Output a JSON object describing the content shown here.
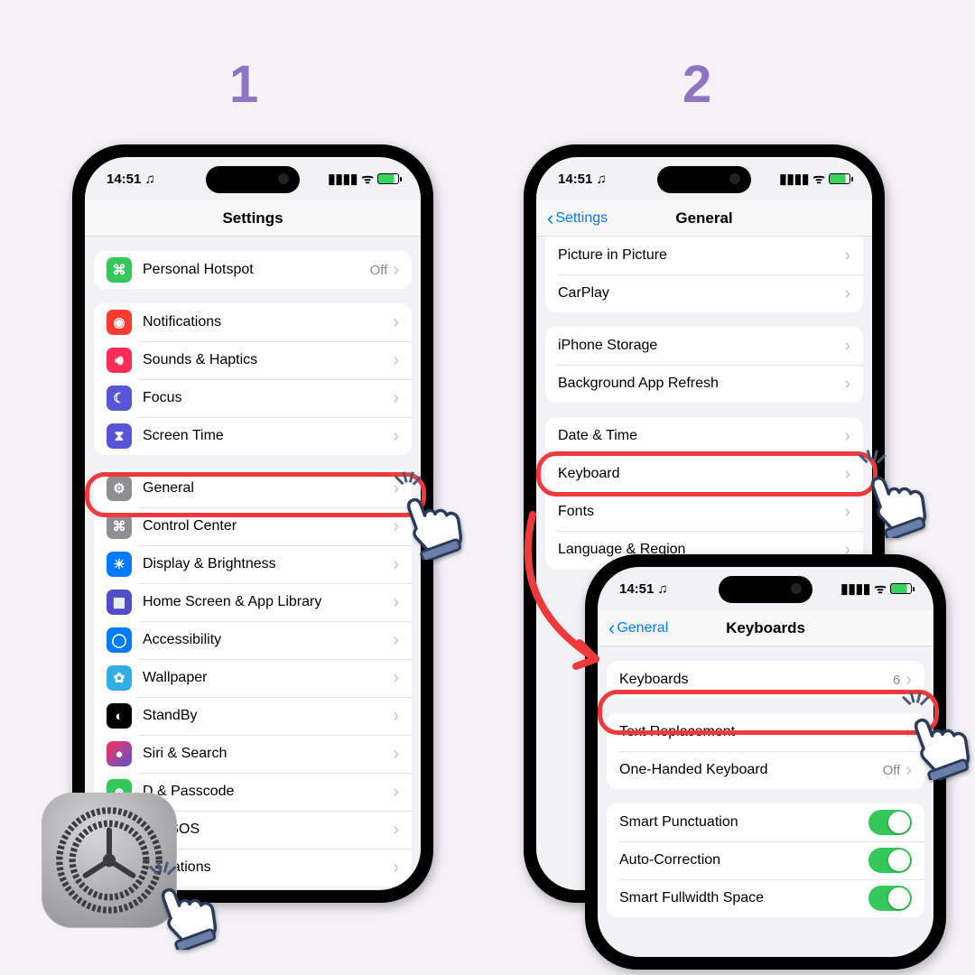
{
  "steps": {
    "one": "1",
    "two": "2"
  },
  "status": {
    "time": "14:51",
    "headphones": "🎧",
    "signal": ".ıll",
    "wifi": "wifi",
    "charge": "⚡︎"
  },
  "phone1": {
    "title": "Settings",
    "g0": [
      {
        "icon": "#34c759",
        "glyph": "link-icon",
        "label": "Personal Hotspot",
        "value": "Off"
      }
    ],
    "g1": [
      {
        "icon": "#ff3b30",
        "glyph": "bell-icon",
        "label": "Notifications"
      },
      {
        "icon": "#ff2d55",
        "glyph": "speaker-icon",
        "label": "Sounds & Haptics"
      },
      {
        "icon": "#5856d6",
        "glyph": "moon-icon",
        "label": "Focus"
      },
      {
        "icon": "#5856d6",
        "glyph": "hourglass-icon",
        "label": "Screen Time"
      }
    ],
    "g2": [
      {
        "icon": "#8e8e93",
        "glyph": "gear-icon",
        "label": "General"
      },
      {
        "icon": "#8e8e93",
        "glyph": "sliders-icon",
        "label": "Control Center"
      },
      {
        "icon": "#007aff",
        "glyph": "sun-icon",
        "label": "Display & Brightness"
      },
      {
        "icon": "#5856d6",
        "glyph": "grid-icon",
        "label": "Home Screen & App Library"
      },
      {
        "icon": "#007aff",
        "glyph": "person-icon",
        "label": "Accessibility"
      },
      {
        "icon": "#32ade6",
        "glyph": "flower-icon",
        "label": "Wallpaper"
      },
      {
        "icon": "#000000",
        "glyph": "standby-icon",
        "label": "StandBy"
      },
      {
        "icon": "#000000",
        "glyph": "siri-icon",
        "label": "Siri & Search"
      },
      {
        "icon": "#34c759",
        "glyph": "faceid-icon",
        "label": "D & Passcode",
        "full": "Face ID & Passcode"
      },
      {
        "icon": "#ff3b30",
        "glyph": "sos-icon",
        "label": "ncy SOS",
        "full": "Emergency SOS"
      },
      {
        "icon": "#ff3b30",
        "glyph": "virus-icon",
        "label": "otifications"
      }
    ]
  },
  "phone2": {
    "title": "General",
    "back": "Settings",
    "g0": [
      {
        "label": "Picture in Picture"
      },
      {
        "label": "CarPlay"
      }
    ],
    "g1": [
      {
        "label": "iPhone Storage"
      },
      {
        "label": "Background App Refresh"
      }
    ],
    "g2": [
      {
        "label": "Date & Time"
      },
      {
        "label": "Keyboard"
      },
      {
        "label": "Fonts"
      },
      {
        "label": "Language & Region"
      }
    ]
  },
  "phone3": {
    "title": "Keyboards",
    "back": "General",
    "g0": [
      {
        "label": "Keyboards",
        "value": "6"
      }
    ],
    "g1": [
      {
        "label": "Text Replacement"
      },
      {
        "label": "One-Handed Keyboard",
        "value": "Off"
      }
    ],
    "g2": [
      {
        "label": "Smart Punctuation",
        "toggle": true
      },
      {
        "label": "Auto-Correction",
        "toggle": true
      },
      {
        "label": "Smart Fullwidth Space",
        "toggle": true
      }
    ]
  },
  "strings": {
    "chevron": "›",
    "back_chevron": "‹",
    "headphone": "🎧"
  }
}
